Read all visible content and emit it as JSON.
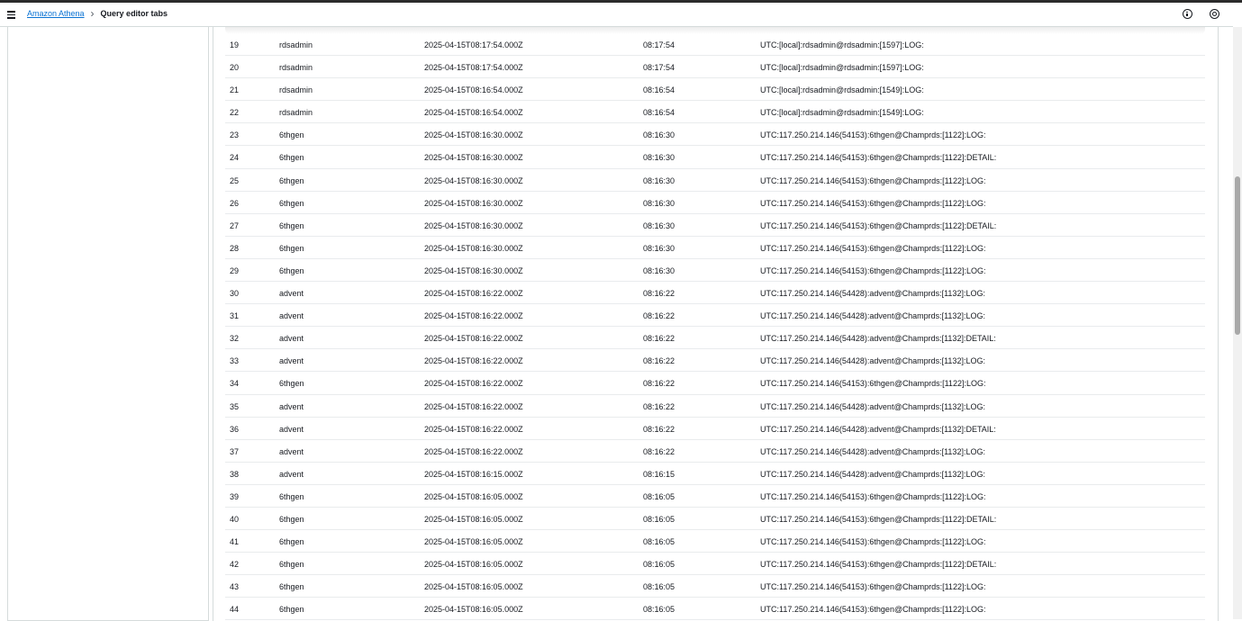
{
  "header": {
    "breadcrumb_root": "Amazon Athena",
    "breadcrumb_current": "Query editor tabs",
    "menu_icon": "hamburger-icon",
    "info_icon": "info-icon",
    "settings_icon": "settings-icon"
  },
  "rows": [
    {
      "n": "19",
      "user": "rdsadmin",
      "ts": "2025-04-15T08:17:54.000Z",
      "time": "08:17:54",
      "msg": "UTC:[local]:rdsadmin@rdsadmin:[1597]:LOG:"
    },
    {
      "n": "20",
      "user": "rdsadmin",
      "ts": "2025-04-15T08:17:54.000Z",
      "time": "08:17:54",
      "msg": "UTC:[local]:rdsadmin@rdsadmin:[1597]:LOG:"
    },
    {
      "n": "21",
      "user": "rdsadmin",
      "ts": "2025-04-15T08:16:54.000Z",
      "time": "08:16:54",
      "msg": "UTC:[local]:rdsadmin@rdsadmin:[1549]:LOG:"
    },
    {
      "n": "22",
      "user": "rdsadmin",
      "ts": "2025-04-15T08:16:54.000Z",
      "time": "08:16:54",
      "msg": "UTC:[local]:rdsadmin@rdsadmin:[1549]:LOG:"
    },
    {
      "n": "23",
      "user": "6thgen",
      "ts": "2025-04-15T08:16:30.000Z",
      "time": "08:16:30",
      "msg": "UTC:117.250.214.146(54153):6thgen@Champrds:[1122]:LOG:"
    },
    {
      "n": "24",
      "user": "6thgen",
      "ts": "2025-04-15T08:16:30.000Z",
      "time": "08:16:30",
      "msg": "UTC:117.250.214.146(54153):6thgen@Champrds:[1122]:DETAIL:"
    },
    {
      "n": "25",
      "user": "6thgen",
      "ts": "2025-04-15T08:16:30.000Z",
      "time": "08:16:30",
      "msg": "UTC:117.250.214.146(54153):6thgen@Champrds:[1122]:LOG:"
    },
    {
      "n": "26",
      "user": "6thgen",
      "ts": "2025-04-15T08:16:30.000Z",
      "time": "08:16:30",
      "msg": "UTC:117.250.214.146(54153):6thgen@Champrds:[1122]:LOG:"
    },
    {
      "n": "27",
      "user": "6thgen",
      "ts": "2025-04-15T08:16:30.000Z",
      "time": "08:16:30",
      "msg": "UTC:117.250.214.146(54153):6thgen@Champrds:[1122]:DETAIL:"
    },
    {
      "n": "28",
      "user": "6thgen",
      "ts": "2025-04-15T08:16:30.000Z",
      "time": "08:16:30",
      "msg": "UTC:117.250.214.146(54153):6thgen@Champrds:[1122]:LOG:"
    },
    {
      "n": "29",
      "user": "6thgen",
      "ts": "2025-04-15T08:16:30.000Z",
      "time": "08:16:30",
      "msg": "UTC:117.250.214.146(54153):6thgen@Champrds:[1122]:LOG:"
    },
    {
      "n": "30",
      "user": "advent",
      "ts": "2025-04-15T08:16:22.000Z",
      "time": "08:16:22",
      "msg": "UTC:117.250.214.146(54428):advent@Champrds:[1132]:LOG:"
    },
    {
      "n": "31",
      "user": "advent",
      "ts": "2025-04-15T08:16:22.000Z",
      "time": "08:16:22",
      "msg": "UTC:117.250.214.146(54428):advent@Champrds:[1132]:LOG:"
    },
    {
      "n": "32",
      "user": "advent",
      "ts": "2025-04-15T08:16:22.000Z",
      "time": "08:16:22",
      "msg": "UTC:117.250.214.146(54428):advent@Champrds:[1132]:DETAIL:"
    },
    {
      "n": "33",
      "user": "advent",
      "ts": "2025-04-15T08:16:22.000Z",
      "time": "08:16:22",
      "msg": "UTC:117.250.214.146(54428):advent@Champrds:[1132]:LOG:"
    },
    {
      "n": "34",
      "user": "6thgen",
      "ts": "2025-04-15T08:16:22.000Z",
      "time": "08:16:22",
      "msg": "UTC:117.250.214.146(54153):6thgen@Champrds:[1122]:LOG:"
    },
    {
      "n": "35",
      "user": "advent",
      "ts": "2025-04-15T08:16:22.000Z",
      "time": "08:16:22",
      "msg": "UTC:117.250.214.146(54428):advent@Champrds:[1132]:LOG:"
    },
    {
      "n": "36",
      "user": "advent",
      "ts": "2025-04-15T08:16:22.000Z",
      "time": "08:16:22",
      "msg": "UTC:117.250.214.146(54428):advent@Champrds:[1132]:DETAIL:"
    },
    {
      "n": "37",
      "user": "advent",
      "ts": "2025-04-15T08:16:22.000Z",
      "time": "08:16:22",
      "msg": "UTC:117.250.214.146(54428):advent@Champrds:[1132]:LOG:"
    },
    {
      "n": "38",
      "user": "advent",
      "ts": "2025-04-15T08:16:15.000Z",
      "time": "08:16:15",
      "msg": "UTC:117.250.214.146(54428):advent@Champrds:[1132]:LOG:"
    },
    {
      "n": "39",
      "user": "6thgen",
      "ts": "2025-04-15T08:16:05.000Z",
      "time": "08:16:05",
      "msg": "UTC:117.250.214.146(54153):6thgen@Champrds:[1122]:LOG:"
    },
    {
      "n": "40",
      "user": "6thgen",
      "ts": "2025-04-15T08:16:05.000Z",
      "time": "08:16:05",
      "msg": "UTC:117.250.214.146(54153):6thgen@Champrds:[1122]:DETAIL:"
    },
    {
      "n": "41",
      "user": "6thgen",
      "ts": "2025-04-15T08:16:05.000Z",
      "time": "08:16:05",
      "msg": "UTC:117.250.214.146(54153):6thgen@Champrds:[1122]:LOG:"
    },
    {
      "n": "42",
      "user": "6thgen",
      "ts": "2025-04-15T08:16:05.000Z",
      "time": "08:16:05",
      "msg": "UTC:117.250.214.146(54153):6thgen@Champrds:[1122]:DETAIL:"
    },
    {
      "n": "43",
      "user": "6thgen",
      "ts": "2025-04-15T08:16:05.000Z",
      "time": "08:16:05",
      "msg": "UTC:117.250.214.146(54153):6thgen@Champrds:[1122]:LOG:"
    },
    {
      "n": "44",
      "user": "6thgen",
      "ts": "2025-04-15T08:16:05.000Z",
      "time": "08:16:05",
      "msg": "UTC:117.250.214.146(54153):6thgen@Champrds:[1122]:LOG:"
    }
  ]
}
